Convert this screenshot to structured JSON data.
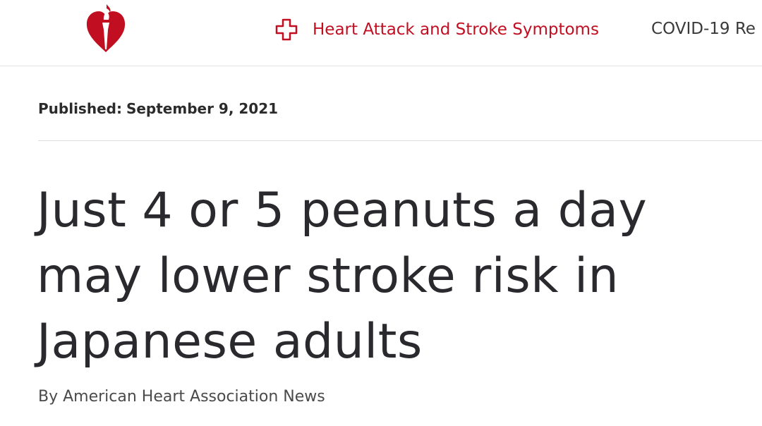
{
  "header": {
    "nav": [
      {
        "label": "Heart Attack and Stroke Symptoms",
        "icon": "medical-cross-icon"
      },
      {
        "label": "COVID-19 Re"
      }
    ]
  },
  "article": {
    "published_label": "Published:",
    "published_date": "September 9, 2021",
    "headline": "Just 4 or 5 peanuts a day may lower stroke risk in Japanese adults",
    "byline": "By American Heart Association News"
  },
  "colors": {
    "brand_red": "#c10e21",
    "text_dark": "#2a2a2e"
  }
}
